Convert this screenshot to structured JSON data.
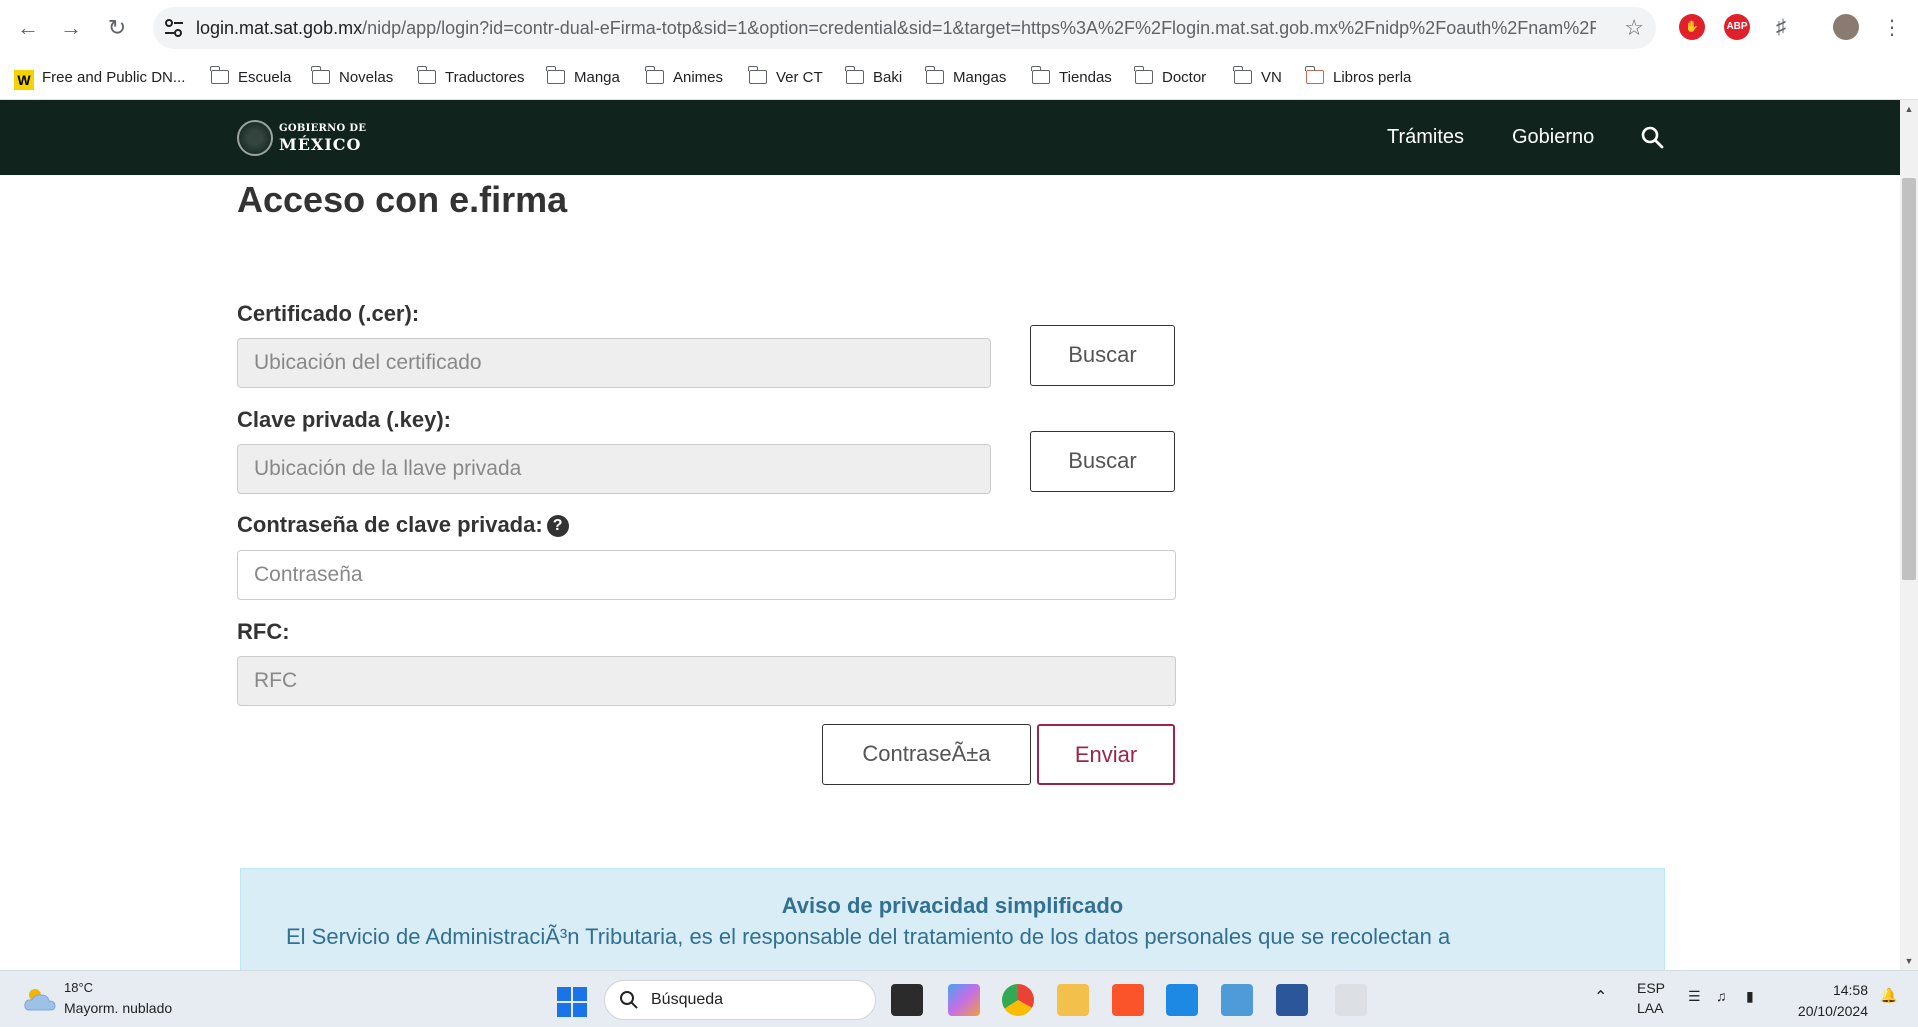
{
  "browser": {
    "url_host": "login.mat.sat.gob.mx",
    "url_rest": "/nidp/app/login?id=contr-dual-eFirma-totp&sid=1&option=credential&sid=1&target=https%3A%2F%2Flogin.mat.sat.gob.mx%2Fnidp%2Foauth%2Fnam%2Fa...",
    "ext_abp_label": "ABP"
  },
  "bookmarks": [
    {
      "label": "Free and Public DN..."
    },
    {
      "label": "Escuela"
    },
    {
      "label": "Novelas"
    },
    {
      "label": "Traductores"
    },
    {
      "label": "Manga"
    },
    {
      "label": "Animes"
    },
    {
      "label": "Ver CT"
    },
    {
      "label": "Baki"
    },
    {
      "label": "Mangas"
    },
    {
      "label": "Tiendas"
    },
    {
      "label": "Doctor"
    },
    {
      "label": "VN"
    },
    {
      "label": "Libros perla"
    }
  ],
  "header": {
    "logo_line1": "GOBIERNO DE",
    "logo_line2": "MÉXICO",
    "nav_tramites": "Trámites",
    "nav_gobierno": "Gobierno"
  },
  "form": {
    "title": "Acceso con e.firma",
    "cert_label": "Certificado (.cer):",
    "cert_placeholder": "Ubicación del certificado",
    "key_label": "Clave privada (.key):",
    "key_placeholder": "Ubicación de la llave privada",
    "buscar_label": "Buscar",
    "password_label": "Contraseña de clave privada:",
    "help_glyph": "?",
    "password_placeholder": "Contraseña",
    "rfc_label": "RFC:",
    "rfc_placeholder": "RFC",
    "password_button": "ContraseÃ±a",
    "send_button": "Enviar"
  },
  "privacy": {
    "title": "Aviso de privacidad simplificado",
    "text_line1": "El Servicio de AdministraciÃ³n Tributaria, es el responsable del tratamiento de los datos personales que se recolectan a"
  },
  "taskbar": {
    "temperature": "18°C",
    "weather": "Mayorm. nublado",
    "search_label": "Búsqueda",
    "lang_top": "ESP",
    "lang_bottom": "LAA",
    "time": "14:58",
    "date": "20/10/2024"
  },
  "colors": {
    "gov_header_bg": "#10231d",
    "accent_maroon": "#9d2449",
    "privacy_bg": "#d9edf7",
    "privacy_text": "#31708f"
  }
}
